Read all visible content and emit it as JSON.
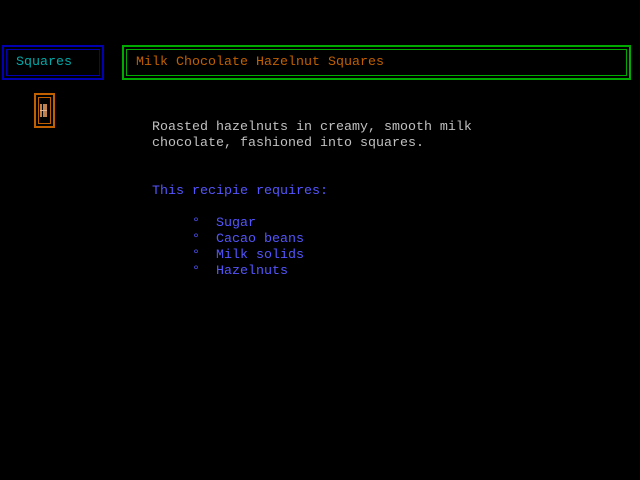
{
  "nav": {
    "label": "Squares"
  },
  "header": {
    "title": "Milk Chocolate Hazelnut Squares"
  },
  "icon": "chocolate-bar-icon",
  "description": [
    "Roasted hazelnuts in creamy, smooth milk",
    "chocolate, fashioned into squares."
  ],
  "requires_label": "This recipie requires:",
  "bullet": "°",
  "ingredients": [
    "Sugar",
    "Cacao beans",
    "Milk solids",
    "Hazelnuts"
  ],
  "colors": {
    "nav_border": "#0000b0",
    "nav_text": "#00aaaa",
    "title_border": "#00aa00",
    "title_text": "#c06000",
    "body_text": "#c0c0c0",
    "list_text": "#5555ff"
  }
}
